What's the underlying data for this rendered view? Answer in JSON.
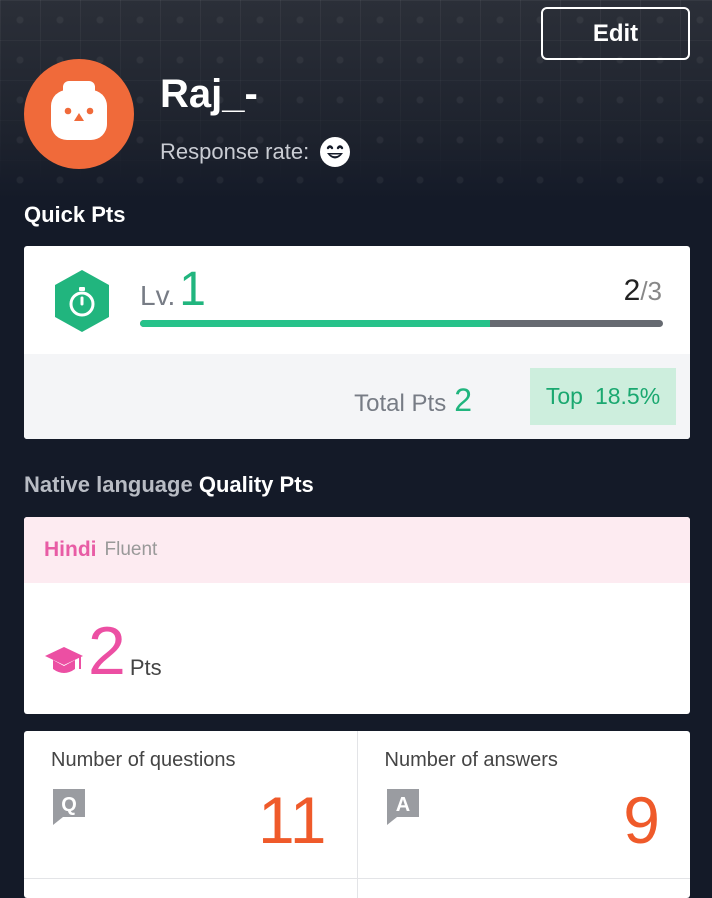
{
  "header": {
    "edit_label": "Edit",
    "username": "Raj_-",
    "response_label": "Response rate:",
    "response_icon": "grinning-face-icon"
  },
  "quick_pts": {
    "section_title": "Quick Pts",
    "level_prefix": "Lv.",
    "level": "1",
    "progress_current": "2",
    "progress_max": "/3",
    "progress_fraction": 0.67,
    "total_label": "Total Pts",
    "total_value": "2",
    "top_label": "Top",
    "top_value": "18.5%",
    "accent_color": "#21b57e"
  },
  "native": {
    "section_prefix": "Native language",
    "section_title": "Quality Pts",
    "language": "Hindi",
    "fluency": "Fluent",
    "pts_value": "2",
    "pts_unit": "Pts",
    "accent_color": "#ec4fa3"
  },
  "stats": {
    "questions_label": "Number of questions",
    "questions_value": "11",
    "answers_label": "Number of answers",
    "answers_value": "9",
    "accent_color": "#ef5a2a"
  }
}
